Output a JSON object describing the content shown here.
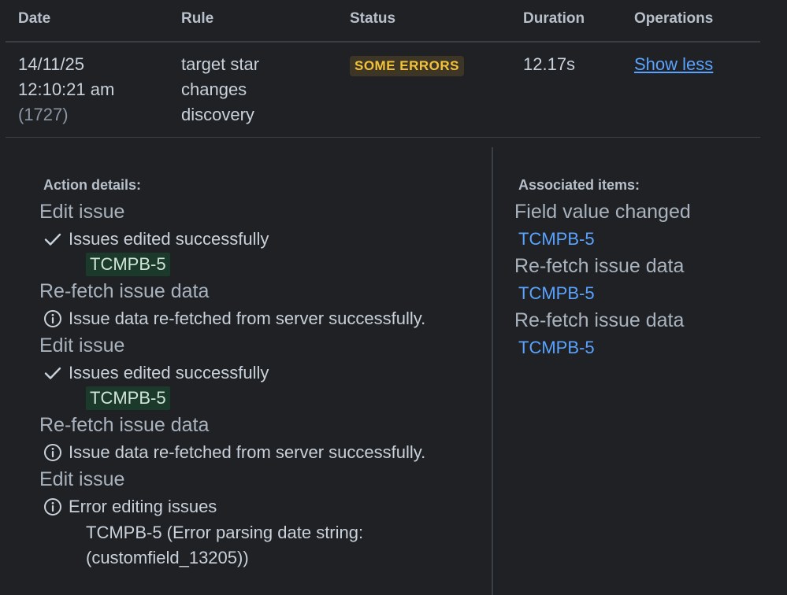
{
  "table": {
    "headers": [
      "Date",
      "Rule",
      "Status",
      "Duration",
      "Operations"
    ]
  },
  "row": {
    "date_line1": "14/11/25",
    "date_line2": "12:10:21 am",
    "date_id": "(1727)",
    "rule_line1": "target star",
    "rule_line2": "changes",
    "rule_line3": "discovery",
    "status": "SOME ERRORS",
    "duration": "12.17s",
    "operation_link": "Show less"
  },
  "details": {
    "action_heading": "Action details:",
    "assoc_heading": "Associated items:",
    "actions": [
      {
        "title": "Edit issue",
        "icon": "check-icon",
        "message": "Issues edited successfully",
        "tag": "TCMPB-5"
      },
      {
        "title": "Re-fetch issue data",
        "icon": "info-icon",
        "message": "Issue data re-fetched from server successfully."
      },
      {
        "title": "Edit issue",
        "icon": "check-icon",
        "message": "Issues edited successfully",
        "tag": "TCMPB-5"
      },
      {
        "title": "Re-fetch issue data",
        "icon": "info-icon",
        "message": "Issue data re-fetched from server successfully."
      },
      {
        "title": "Edit issue",
        "icon": "info-icon",
        "message": "Error editing issues",
        "error_line1": "TCMPB-5 (Error parsing date string:",
        "error_line2": "(customfield_13205))"
      }
    ],
    "associated": [
      {
        "title": "Field value changed",
        "item": "TCMPB-5"
      },
      {
        "title": "Re-fetch issue data",
        "item": "TCMPB-5"
      },
      {
        "title": "Re-fetch issue data",
        "item": "TCMPB-5"
      }
    ]
  },
  "colors": {
    "background": "#1f2125",
    "status_badge_bg": "#3d3526",
    "status_badge_text": "#f2c23a",
    "link": "#5aa3ff",
    "tag_bg": "#1c3a2c"
  }
}
